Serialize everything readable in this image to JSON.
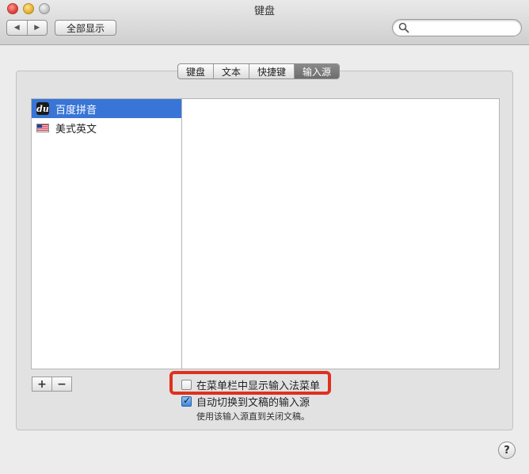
{
  "window": {
    "title": "键盘"
  },
  "toolbar": {
    "back_icon": "◀",
    "forward_icon": "▶",
    "show_all_label": "全部显示",
    "search": {
      "value": "",
      "placeholder": ""
    }
  },
  "tabs": [
    {
      "label": "键盘",
      "active": false
    },
    {
      "label": "文本",
      "active": false
    },
    {
      "label": "快捷键",
      "active": false
    },
    {
      "label": "输入源",
      "active": true
    }
  ],
  "input_sources": [
    {
      "label": "百度拼音",
      "icon": "baidu-du-icon",
      "icon_text": "du",
      "selected": true
    },
    {
      "label": "美式英文",
      "icon": "us-flag-icon",
      "selected": false
    }
  ],
  "list_controls": {
    "add_label": "+",
    "remove_label": "−"
  },
  "options": {
    "show_menu": {
      "label": "在菜单栏中显示输入法菜单",
      "checked": false
    },
    "auto_switch": {
      "label": "自动切换到文稿的输入源",
      "checked": true
    },
    "auto_switch_note": "使用该输入源直到关闭文稿。"
  },
  "help_label": "?",
  "colors": {
    "selection": "#3875d7",
    "highlight": "#e0301e"
  }
}
